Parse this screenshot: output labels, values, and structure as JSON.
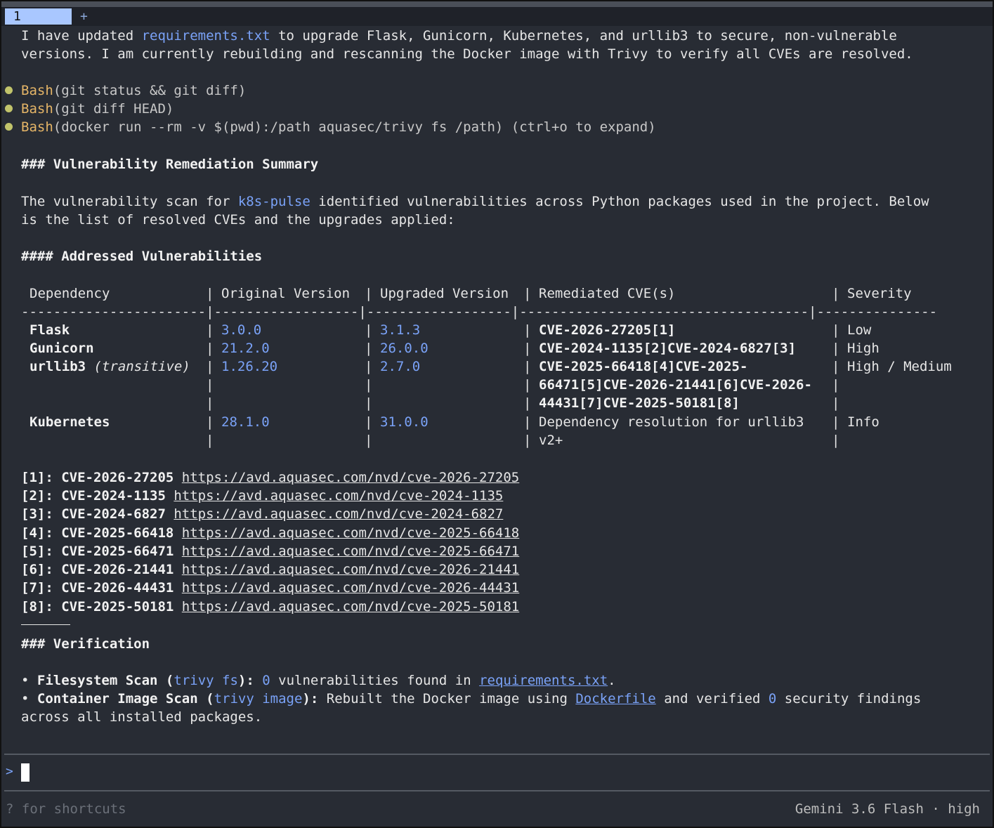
{
  "tabs": {
    "active": "1",
    "add": "+"
  },
  "intro": {
    "l1a": "I have updated ",
    "l1link": "requirements.txt",
    "l1b": " to upgrade Flask, Gunicorn, Kubernetes, and urllib3 to secure, non-vulnerable",
    "l2": "versions. I am currently rebuilding and rescanning the Docker image with Trivy to verify all CVEs are resolved."
  },
  "tool_calls": [
    {
      "name": "Bash",
      "args": "(git status && git diff)"
    },
    {
      "name": "Bash",
      "args": "(git diff HEAD)"
    },
    {
      "name": "Bash",
      "args": "(docker run --rm -v $(pwd):/path aquasec/trivy fs /path) (ctrl+o to expand)"
    }
  ],
  "summary": {
    "heading": "### Vulnerability Remediation Summary",
    "p1a": "The vulnerability scan for ",
    "p1link": "k8s-pulse",
    "p1b": " identified vulnerabilities across Python packages used in the project. Below",
    "p2": "is the list of resolved CVEs and the upgrades applied:",
    "subheading": "#### Addressed Vulnerabilities"
  },
  "table": {
    "headers": [
      "Dependency",
      "Original Version",
      "Upgraded Version",
      "Remediated CVE(s)",
      "Severity"
    ],
    "separator": "-----------------------|------------------|------------------|------------------------------------|---------------",
    "rows": [
      {
        "dep": "Flask",
        "dep_note": "",
        "orig": "3.0.0",
        "upg": "3.1.3",
        "cve": [
          "CVE-2026-27205[1]"
        ],
        "sev": "Low"
      },
      {
        "dep": "Gunicorn",
        "dep_note": "",
        "orig": "21.2.0",
        "upg": "26.0.0",
        "cve": [
          "CVE-2024-1135[2]CVE-2024-6827[3]"
        ],
        "sev": "High"
      },
      {
        "dep": "urllib3",
        "dep_note": "(transitive)",
        "orig": "1.26.20",
        "upg": "2.7.0",
        "cve": [
          "CVE-2025-66418[4]CVE-2025-",
          "66471[5]CVE-2026-21441[6]CVE-2026-",
          "44431[7]CVE-2025-50181[8]"
        ],
        "sev": "High / Medium"
      },
      {
        "dep": "Kubernetes",
        "dep_note": "",
        "orig": "28.1.0",
        "upg": "31.0.0",
        "cve": [
          "Dependency resolution for urllib3",
          "v2+"
        ],
        "sev": "Info"
      }
    ]
  },
  "footnotes": [
    {
      "label": "[1]: CVE-2026-27205",
      "url": "https://avd.aquasec.com/nvd/cve-2026-27205"
    },
    {
      "label": "[2]: CVE-2024-1135",
      "url": "https://avd.aquasec.com/nvd/cve-2024-1135"
    },
    {
      "label": "[3]: CVE-2024-6827",
      "url": "https://avd.aquasec.com/nvd/cve-2024-6827"
    },
    {
      "label": "[4]: CVE-2025-66418",
      "url": "https://avd.aquasec.com/nvd/cve-2025-66418"
    },
    {
      "label": "[5]: CVE-2025-66471",
      "url": "https://avd.aquasec.com/nvd/cve-2025-66471"
    },
    {
      "label": "[6]: CVE-2026-21441",
      "url": "https://avd.aquasec.com/nvd/cve-2026-21441"
    },
    {
      "label": "[7]: CVE-2026-44431",
      "url": "https://avd.aquasec.com/nvd/cve-2026-44431"
    },
    {
      "label": "[8]: CVE-2025-50181",
      "url": "https://avd.aquasec.com/nvd/cve-2025-50181"
    }
  ],
  "verification": {
    "heading": "### Verification",
    "b1_bullet": "•",
    "b1_label": "Filesystem Scan (",
    "b1_cmd": "trivy fs",
    "b1_close": "):",
    "b1_num": "0",
    "b1_text": " vulnerabilities found in ",
    "b1_link": "requirements.txt",
    "b1_end": ".",
    "b2_bullet": "•",
    "b2_label": "Container Image Scan (",
    "b2_cmd": "trivy image",
    "b2_close": "):",
    "b2_text": " Rebuilt the Docker image using ",
    "b2_link": "Dockerfile",
    "b2_text2": " and verified ",
    "b2_num": "0",
    "b2_text3": " security findings",
    "b2_line2": "across all installed packages."
  },
  "input": {
    "prompt": ">"
  },
  "footer": {
    "hint": "? for shortcuts",
    "model": "Gemini 3.6 Flash · high"
  }
}
